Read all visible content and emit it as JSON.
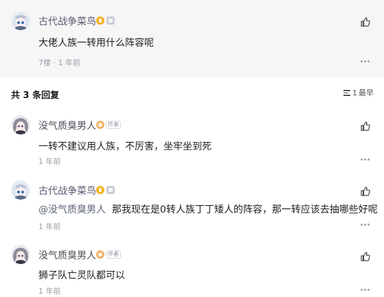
{
  "op": {
    "username": "古代战争菜鸟",
    "content": "大佬人族一转用什么阵容呢",
    "meta": "7楼 · 1 年前"
  },
  "replies_header": {
    "title": "共 3 条回复",
    "sort_count": "1",
    "sort_label": "最早"
  },
  "replies": [
    {
      "username": "没气质臭男人",
      "badge": "作者",
      "content": "一转不建议用人族，不厉害，坐牢坐到死",
      "meta": "1 年前"
    },
    {
      "username": "古代战争菜鸟",
      "mention": "@没气质臭男人",
      "content": "那我现在是0转人族丁丁矮人的阵容，那一转应该去抽哪些好呢",
      "meta": "1 年前"
    },
    {
      "username": "没气质臭男人",
      "badge": "作者",
      "content": "狮子队亡灵队都可以",
      "meta": "1 年前"
    }
  ],
  "colors": {
    "op_background": "#f6f6f7",
    "level_gold": "#f5b324",
    "level_orange": "#f1b264"
  },
  "icons": [
    "like-icon",
    "more-icon",
    "sort-icon",
    "level-icon",
    "medal-icon"
  ]
}
